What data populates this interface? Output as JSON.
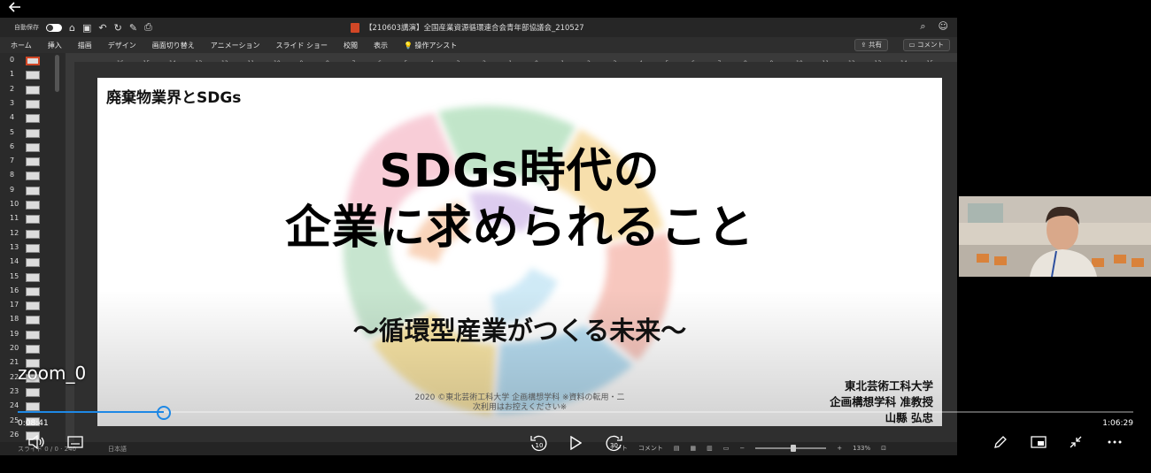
{
  "player": {
    "back_icon": "arrow-left-icon",
    "zoom_label": "zoom_0",
    "current_time": "0:08:41",
    "total_time": "1:06:29",
    "progress": 0.1306,
    "controls": {
      "volume_icon": "volume-icon",
      "captions_icon": "captions-icon",
      "rewind_label": "10",
      "forward_label": "30",
      "play_icon": "play-icon",
      "pen_icon": "pen-icon",
      "pip_icon": "picture-in-picture-icon",
      "collapse_icon": "collapse-icon",
      "more_icon": "more-icon"
    }
  },
  "ppt": {
    "autosave_label": "自動保存",
    "doc_title": "【210603講演】全国産業資源循環連合会青年部協議会_210527",
    "menu": [
      "ホーム",
      "挿入",
      "描画",
      "デザイン",
      "画面切り替え",
      "アニメーション",
      "スライド ショー",
      "校閲",
      "表示",
      "操作アシスト"
    ],
    "share_label": "共有",
    "comment_label": "コメント",
    "thumb_numbers": [
      "0",
      "1",
      "2",
      "3",
      "4",
      "5",
      "6",
      "7",
      "8",
      "9",
      "10",
      "11",
      "12",
      "13",
      "14",
      "15",
      "16",
      "17",
      "18",
      "19",
      "20",
      "21",
      "22",
      "23",
      "24",
      "25",
      "26"
    ],
    "status_slide": "スライド 0 / 0",
    "status_total": "240",
    "status_lang": "日本語",
    "status_notes": "ノート",
    "status_comments": "コメント",
    "zoom_percent": "133%",
    "ruler_numbers": [
      "16",
      "15",
      "14",
      "13",
      "12",
      "11",
      "10",
      "9",
      "8",
      "7",
      "6",
      "5",
      "4",
      "3",
      "2",
      "1",
      "0",
      "1",
      "2",
      "3",
      "4",
      "5",
      "6",
      "7",
      "8",
      "9",
      "10",
      "11",
      "12",
      "13",
      "14",
      "15",
      "16"
    ]
  },
  "slide": {
    "header": "廃棄物業界とSDGs",
    "title_line1": "SDGs時代の",
    "title_line2": "企業に求められること",
    "subtitle": "〜循環型産業がつくる未来〜",
    "copyright_line1": "2020 ©東北芸術工科大学 企画構想学科 ※資料の転用・二",
    "copyright_line2": "次利用はお控えください※",
    "presenter_line1": "東北芸術工科大学",
    "presenter_line2": "企画構想学科 准教授",
    "presenter_line3": "山縣 弘忠"
  },
  "colors": {
    "accent": "#1e88e5",
    "ppt_brand": "#d24726"
  }
}
